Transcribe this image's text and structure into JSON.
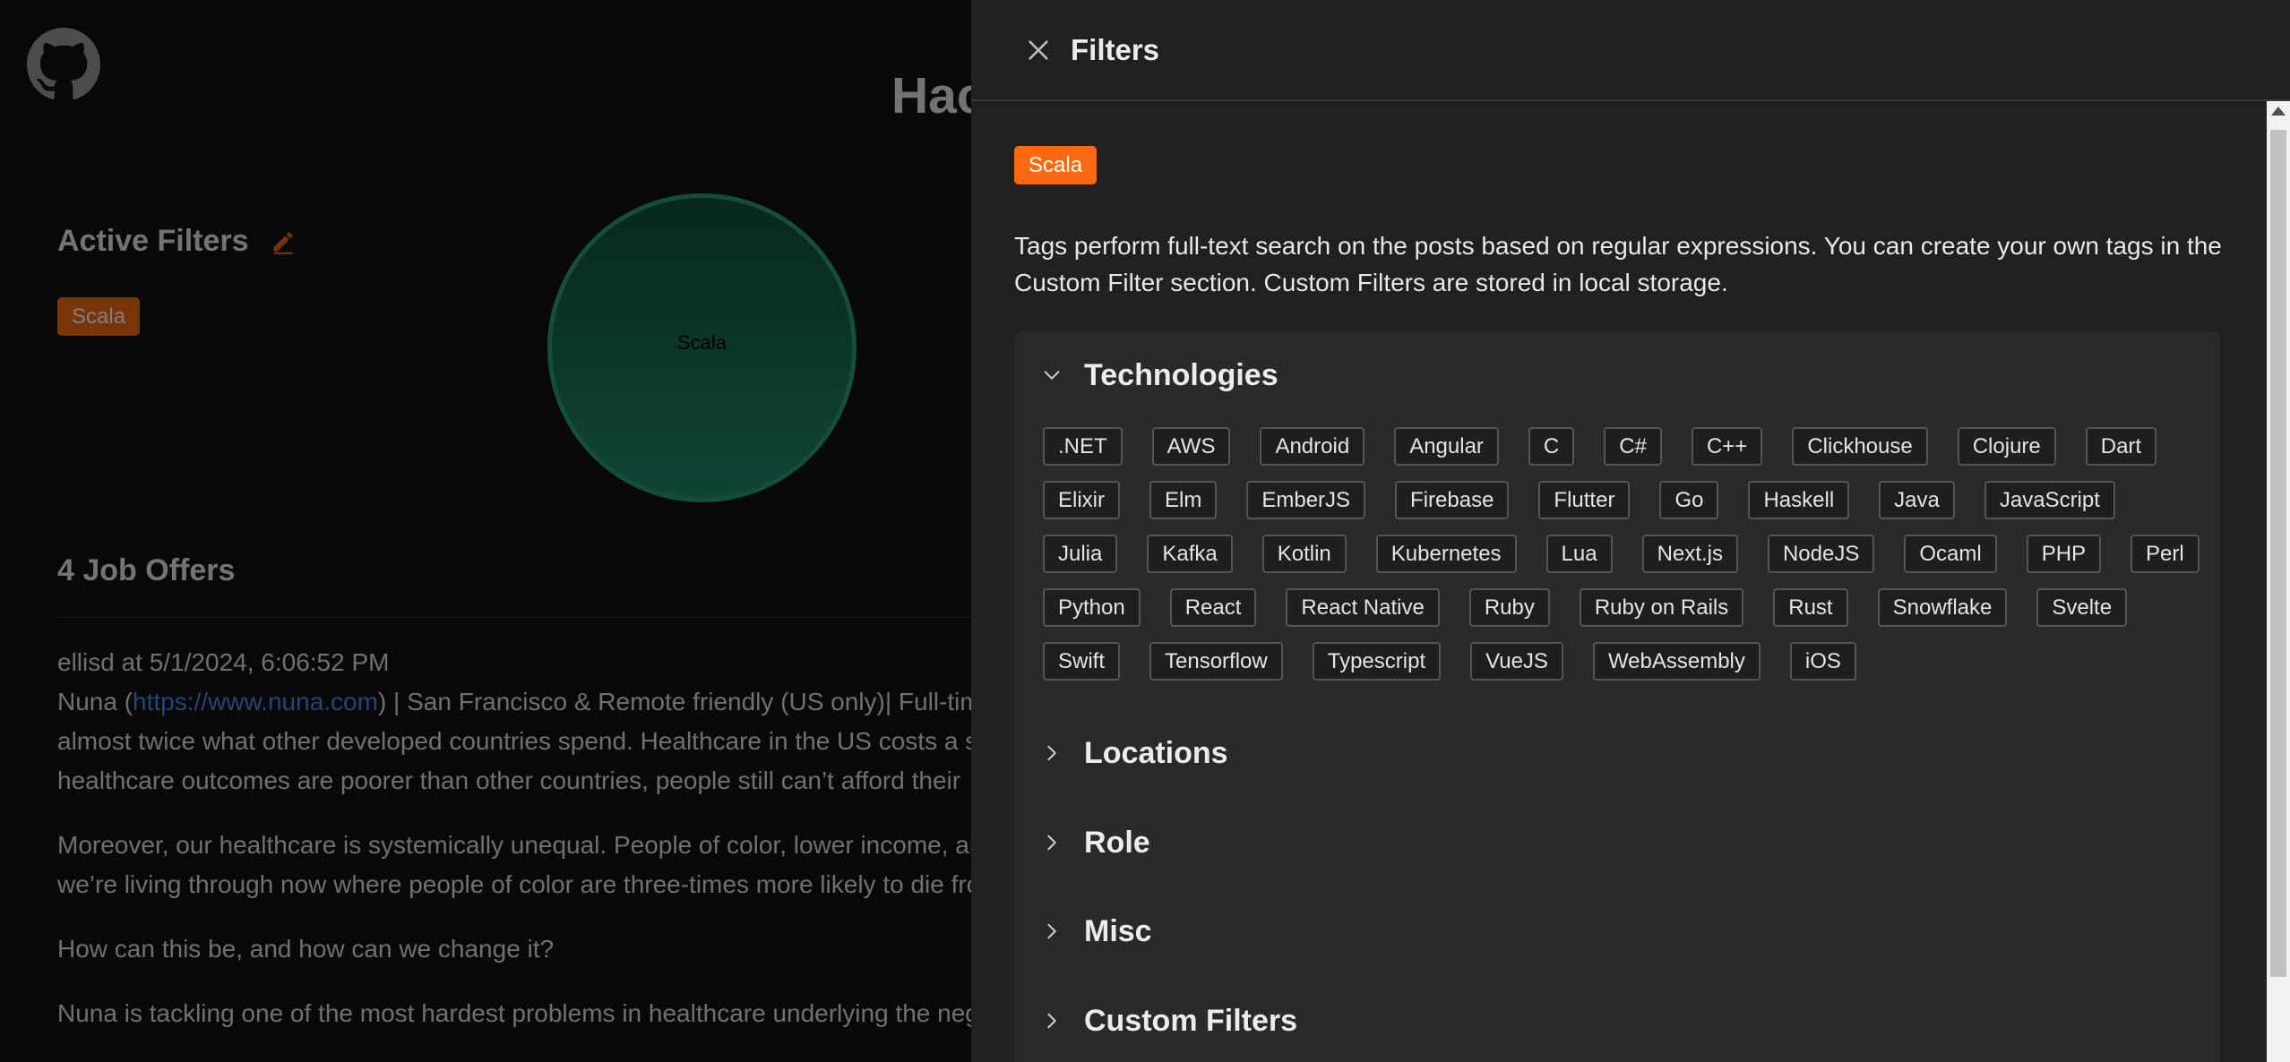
{
  "background": {
    "heading": "Hac",
    "active_filters_title": "Active Filters",
    "active_tag": "Scala",
    "bubble_label": "Scala",
    "offers_title": "4 Job Offers",
    "post": {
      "meta": "ellisd at 5/1/2024, 6:06:52 PM",
      "line1_prefix": "Nuna (",
      "line1_link": "https://www.nuna.com",
      "line1_suffix": ") | San Francisco & Remote friendly (US only)| Full-tim",
      "line2": "almost twice what other developed countries spend. Healthcare in the US costs a s",
      "line3": "healthcare outcomes are poorer than other countries, people still can’t afford their",
      "para2_line1": "Moreover, our healthcare is systemically unequal. People of color, lower income, ar",
      "para2_line2": "we’re living through now where people of color are three-times more likely to die fro",
      "para3": "How can this be, and how can we change it?",
      "para4": "Nuna is tackling one of the most hardest problems in healthcare underlying the neg"
    }
  },
  "drawer": {
    "title": "Filters",
    "selected_tag": "Scala",
    "help_text": "Tags perform full-text search on the posts based on regular expressions. You can create your own tags in the Custom Filter section. Custom Filters are stored in local storage.",
    "sections": [
      {
        "title": "Technologies",
        "expanded": true
      },
      {
        "title": "Locations",
        "expanded": false
      },
      {
        "title": "Role",
        "expanded": false
      },
      {
        "title": "Misc",
        "expanded": false
      },
      {
        "title": "Custom Filters",
        "expanded": false
      }
    ],
    "technologies": [
      [
        ".NET",
        "AWS",
        "Android",
        "Angular",
        "C",
        "C#",
        "C++",
        "Clickhouse",
        "Clojure",
        "Dart"
      ],
      [
        "Elixir",
        "Elm",
        "EmberJS",
        "Firebase",
        "Flutter",
        "Go",
        "Haskell",
        "Java",
        "JavaScript"
      ],
      [
        "Julia",
        "Kafka",
        "Kotlin",
        "Kubernetes",
        "Lua",
        "Next.js",
        "NodeJS",
        "Ocaml",
        "PHP",
        "Perl"
      ],
      [
        "Python",
        "React",
        "React Native",
        "Ruby",
        "Ruby on Rails",
        "Rust",
        "Snowflake",
        "Svelte"
      ],
      [
        "Swift",
        "Tensorflow",
        "Typescript",
        "VueJS",
        "WebAssembly",
        "iOS"
      ]
    ]
  },
  "colors": {
    "accent": "#ff6a10",
    "bubble": "#1f8b68",
    "link": "#4a8be8",
    "drawer_bg": "#212121",
    "accordion_bg": "#2a2a2a"
  }
}
